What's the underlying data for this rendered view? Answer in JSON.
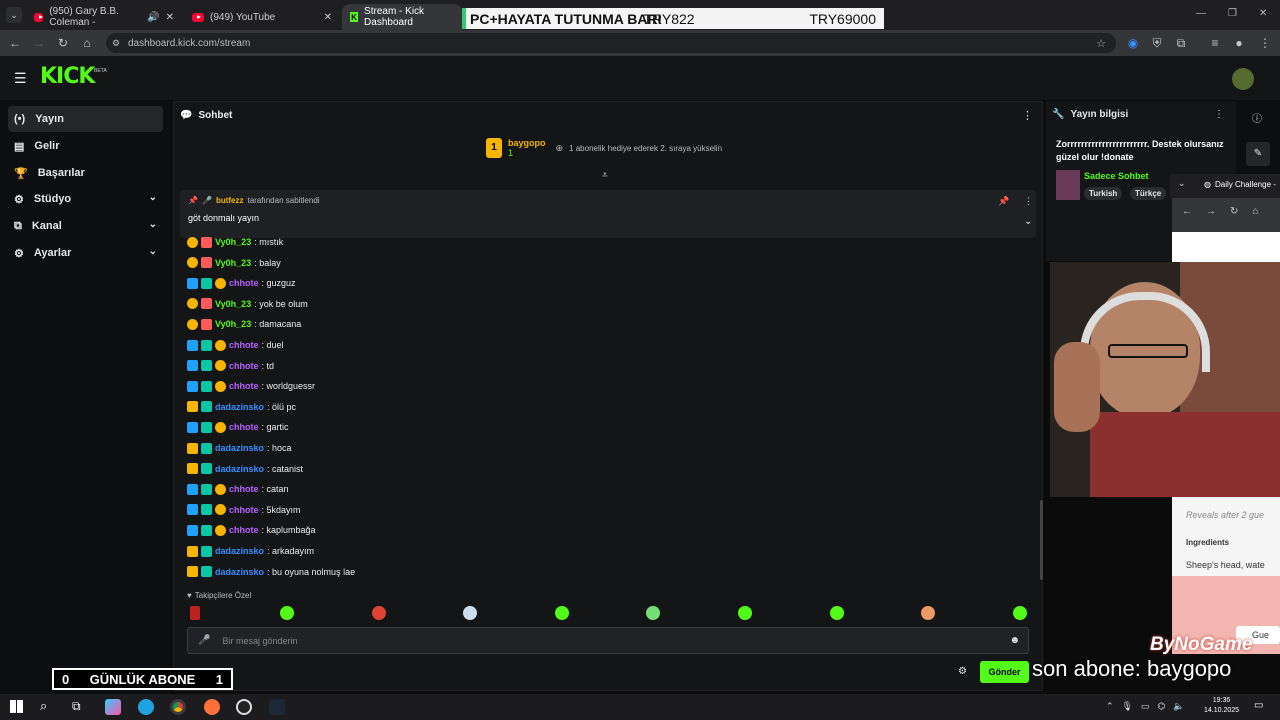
{
  "browser": {
    "tabs": [
      {
        "label": "(950) Gary B.B. Coleman - ",
        "icon": "youtube-icon"
      },
      {
        "label": "(949) YouTube",
        "icon": "youtube-icon"
      },
      {
        "label": "Stream - Kick Dashboard",
        "icon": "kick-icon"
      }
    ],
    "url": "dashboard.kick.com/stream"
  },
  "overlay_banner": {
    "left": "PC+HAYATA TUTUNMA BARI",
    "mid": "TRY822",
    "right": "TRY69000"
  },
  "kick": {
    "logo": "KICK",
    "beta": "BETA"
  },
  "sidebar": {
    "items": [
      {
        "label": "Yayın",
        "icon": "broadcast-icon"
      },
      {
        "label": "Gelir",
        "icon": "wallet-icon"
      },
      {
        "label": "Başarılar",
        "icon": "trophy-icon"
      },
      {
        "label": "Stüdyo",
        "icon": "studio-icon"
      },
      {
        "label": "Kanal",
        "icon": "channel-icon"
      },
      {
        "label": "Ayarlar",
        "icon": "gear-icon"
      }
    ]
  },
  "chat": {
    "title": "Sohbet",
    "leader": {
      "name": "baygopo",
      "rank": "1",
      "count": "1",
      "hint": "1 abonelik hediye ederek 2. sıraya yükselin"
    },
    "pinned": {
      "by_user": "butfezz",
      "by_text": "tarafından sabitlendi",
      "message": "göt donmalı yayın"
    },
    "messages": [
      {
        "user": "Vy0h_23",
        "color": "green",
        "badges": [
          "sub",
          "gift"
        ],
        "text": ": mıstık"
      },
      {
        "user": "Vy0h_23",
        "color": "green",
        "badges": [
          "sub",
          "gift"
        ],
        "text": ": balay"
      },
      {
        "user": "chhote",
        "color": "purple",
        "badges": [
          "mod",
          "vip",
          "sub"
        ],
        "text": ": guzguz"
      },
      {
        "user": "Vy0h_23",
        "color": "green",
        "badges": [
          "sub",
          "gift"
        ],
        "text": ": yok be olum"
      },
      {
        "user": "Vy0h_23",
        "color": "green",
        "badges": [
          "sub",
          "gift"
        ],
        "text": ": damacana"
      },
      {
        "user": "chhote",
        "color": "purple",
        "badges": [
          "mod",
          "vip",
          "sub"
        ],
        "text": ": duel"
      },
      {
        "user": "chhote",
        "color": "purple",
        "badges": [
          "mod",
          "vip",
          "sub"
        ],
        "text": ": td"
      },
      {
        "user": "chhote",
        "color": "purple",
        "badges": [
          "mod",
          "vip",
          "sub"
        ],
        "text": ": worldguessr"
      },
      {
        "user": "dadazinsko",
        "color": "blue",
        "badges": [
          "crown",
          "vip"
        ],
        "text": ": ölü pc"
      },
      {
        "user": "chhote",
        "color": "purple",
        "badges": [
          "mod",
          "vip",
          "sub"
        ],
        "text": ": gartic"
      },
      {
        "user": "dadazinsko",
        "color": "blue",
        "badges": [
          "crown",
          "vip"
        ],
        "text": ": hoca"
      },
      {
        "user": "dadazinsko",
        "color": "blue",
        "badges": [
          "crown",
          "vip"
        ],
        "text": ": catanist"
      },
      {
        "user": "chhote",
        "color": "purple",
        "badges": [
          "mod",
          "vip",
          "sub"
        ],
        "text": ": catan"
      },
      {
        "user": "chhote",
        "color": "purple",
        "badges": [
          "mod",
          "vip",
          "sub"
        ],
        "text": ": 5kdayım"
      },
      {
        "user": "chhote",
        "color": "purple",
        "badges": [
          "mod",
          "vip",
          "sub"
        ],
        "text": ": kaplumbağa"
      },
      {
        "user": "dadazinsko",
        "color": "blue",
        "badges": [
          "crown",
          "vip"
        ],
        "text": ": arkadayım"
      },
      {
        "user": "dadazinsko",
        "color": "blue",
        "badges": [
          "crown",
          "vip"
        ],
        "text": ": bu oyuna nolmuş lae"
      }
    ],
    "follower_emotes_label": "Takipçilere Özel",
    "input_placeholder": "Bir mesaj gönderin",
    "send_label": "Gönder"
  },
  "stream_info": {
    "title": "Yayın bilgisi",
    "description": "Zorrrrrrrrrrrrrrrrrrrrrrr. Destek olursanız güzel olur !donate",
    "category": "Sadece Sohbet",
    "tags": [
      "Turkish",
      "Türkçe"
    ]
  },
  "mini_window": {
    "tab": "Daily Challenge -",
    "reveals": "Reveals after 2 gue",
    "ingredients_label": "Ingredients",
    "ingredients": "Sheep's head, wate",
    "guess": "Gue"
  },
  "overlays": {
    "abone_left": "0",
    "abone_label": "GÜNLÜK ABONE",
    "abone_right": "1",
    "last_sub": "son abone: baygopo",
    "watermark": "ByNoGame"
  },
  "taskbar": {
    "time": "19:36",
    "date": "14.10.2025"
  },
  "colors": {
    "kick_green": "#53fc18",
    "bg": "#0b0b0c",
    "panel": "#141517"
  }
}
